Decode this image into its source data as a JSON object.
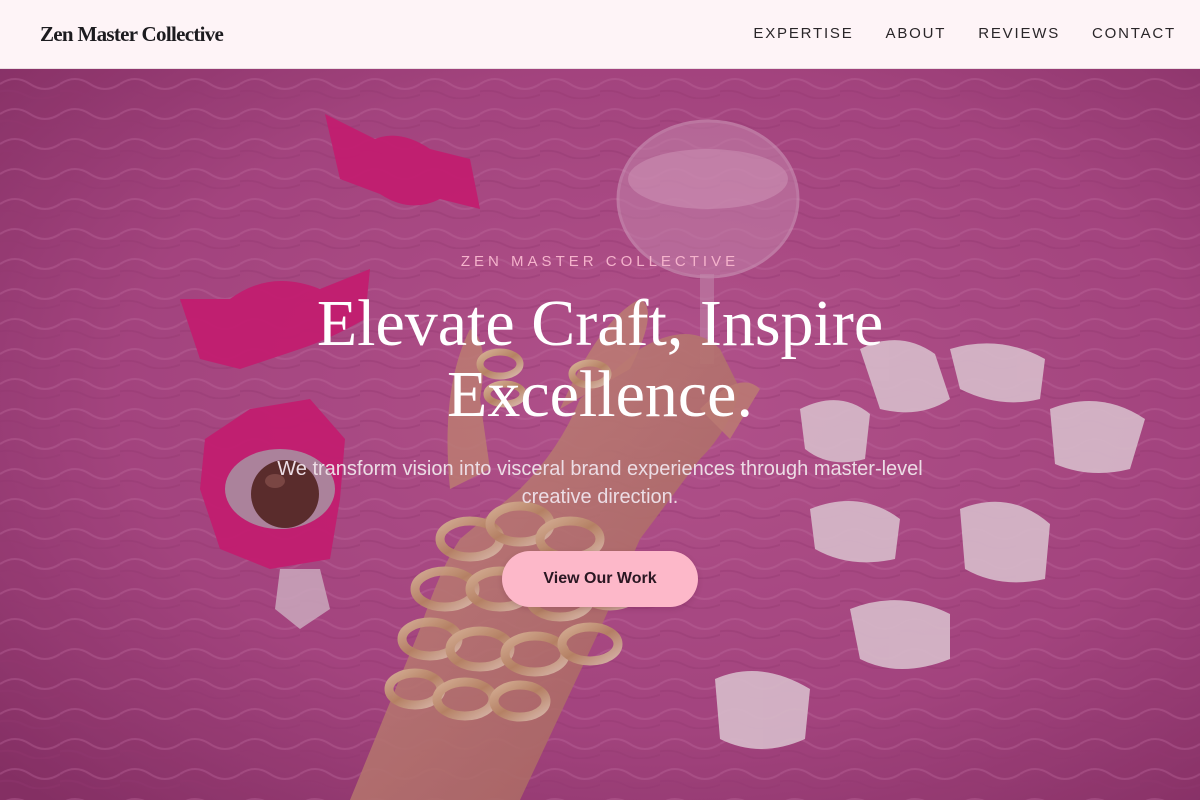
{
  "header": {
    "brand": "Zen Master Collective",
    "nav": [
      {
        "label": "EXPERTISE"
      },
      {
        "label": "ABOUT"
      },
      {
        "label": "REVIEWS"
      },
      {
        "label": "CONTACT"
      }
    ]
  },
  "hero": {
    "eyebrow": "ZEN MASTER COLLECTIVE",
    "headline": "Elevate Craft, Inspire Excellence.",
    "subheadline": "We transform vision into visceral brand experiences through master-level creative direction.",
    "cta_label": "View Our Work"
  },
  "colors": {
    "header_bg": "#fef4f7",
    "eyebrow": "#f5b3cc",
    "cta_bg": "#fdb8c9",
    "hero_tint": "#b04d87"
  },
  "icons": {
    "hero_image": "pink-fur-candy-hand-photo"
  }
}
